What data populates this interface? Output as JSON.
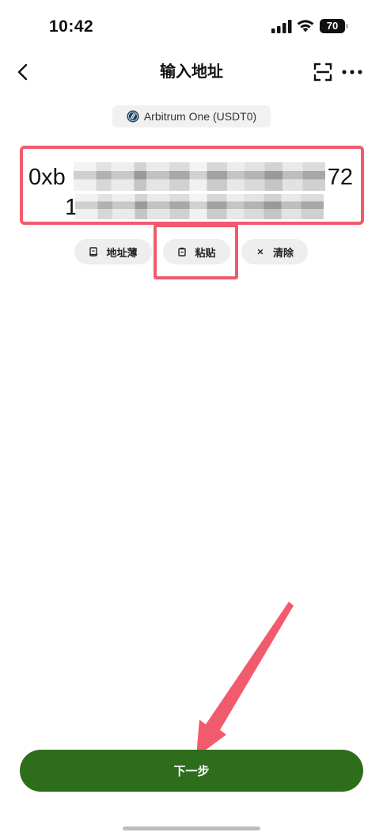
{
  "status_bar": {
    "time": "10:42",
    "battery": "70",
    "icons": [
      "signal-icon",
      "wifi-icon",
      "battery-icon"
    ]
  },
  "nav": {
    "title": "输入地址",
    "icons": [
      "back-icon",
      "scan-icon",
      "more-icon"
    ]
  },
  "network": {
    "label": "Arbitrum One (USDT0)",
    "icon": "arbitrum-logo-icon"
  },
  "address": {
    "line1_start": "0xb",
    "line1_end": "72",
    "line2_start": "1",
    "redacted": true
  },
  "actions": {
    "address_book": "地址薄",
    "paste": "粘贴",
    "clear": "清除",
    "icons": [
      "address-book-icon",
      "clipboard-icon",
      "close-icon"
    ]
  },
  "footer": {
    "next_label": "下一步"
  },
  "colors": {
    "accent_green": "#2d6d1b",
    "annotation_red": "#f25a6d",
    "chip_bg": "#eeeeee"
  }
}
